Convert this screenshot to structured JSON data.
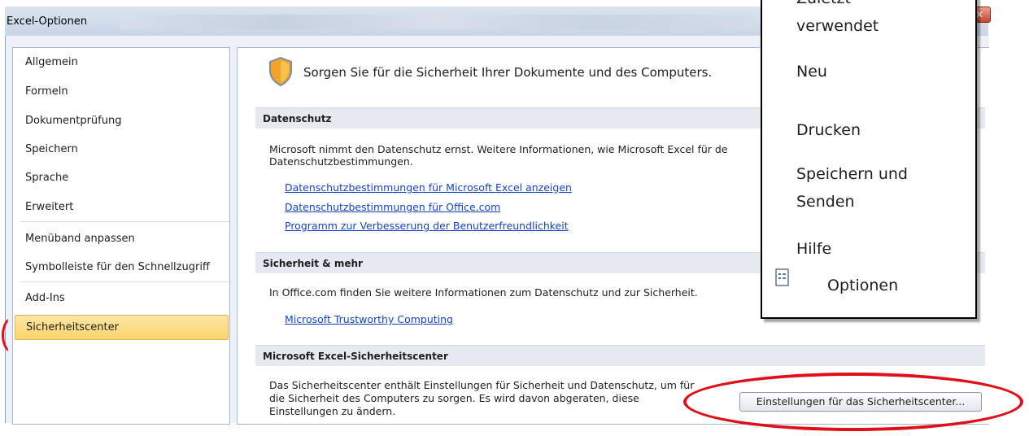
{
  "window": {
    "title": "Excel-Optionen",
    "close_glyph": "✕"
  },
  "nav": {
    "items": [
      {
        "label": "Allgemein"
      },
      {
        "label": "Formeln"
      },
      {
        "label": "Dokumentprüfung"
      },
      {
        "label": "Speichern"
      },
      {
        "label": "Sprache"
      },
      {
        "label": "Erweitert"
      },
      {
        "label": "Menüband anpassen"
      },
      {
        "label": "Symbolleiste für den Schnellzugriff"
      },
      {
        "label": "Add-Ins"
      },
      {
        "label": "Sicherheitscenter"
      }
    ],
    "selected": "Sicherheitscenter"
  },
  "main": {
    "headline": "Sorgen Sie für die Sicherheit Ihrer Dokumente und des Computers.",
    "sections": [
      {
        "title": "Datenschutz",
        "text_lines": [
          "Microsoft nimmt den Datenschutz ernst. Weitere Informationen, wie Microsoft Excel für de",
          "Datenschutzbestimmungen."
        ],
        "links": [
          "Datenschutzbestimmungen für Microsoft Excel anzeigen",
          "Datenschutzbestimmungen für Office.com",
          "Programm zur Verbesserung der Benutzerfreundlichkeit"
        ]
      },
      {
        "title": "Sicherheit & mehr",
        "text_lines": [
          "In Office.com finden Sie weitere Informationen zum Datenschutz und zur Sicherheit."
        ],
        "links": [
          "Microsoft Trustworthy Computing"
        ]
      },
      {
        "title": "Microsoft Excel-Sicherheitscenter",
        "text_lines": [
          "Das Sicherheitscenter enthält Einstellungen für Sicherheit und Datenschutz, um für",
          "die Sicherheit des Computers zu sorgen. Es wird davon abgeraten, diese",
          "Einstellungen zu ändern."
        ],
        "button_label": "Einstellungen für das Sicherheitscenter..."
      }
    ]
  },
  "overlay_menu": {
    "items": [
      {
        "label": "Zuletzt"
      },
      {
        "label": "verwendet"
      },
      {
        "label": "Neu"
      },
      {
        "label": "Drucken"
      },
      {
        "label": "Speichern und"
      },
      {
        "label": "Senden"
      },
      {
        "label": "Hilfe"
      },
      {
        "label": "Optionen",
        "icon": "options-document-icon"
      }
    ]
  },
  "colors": {
    "highlight": "#e0101a",
    "selection": "#fbd46c",
    "link": "#1543c8"
  }
}
